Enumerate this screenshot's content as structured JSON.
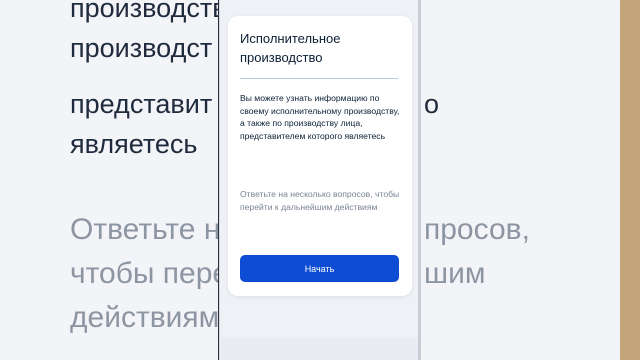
{
  "background": {
    "lines": [
      "производств",
      "производст",
      "представит",
      "являетесь"
    ],
    "right_lines_1": "о",
    "muted_lines": [
      "Ответьте н",
      "чтобы пере",
      "действиям"
    ],
    "muted_right": [
      "просов,",
      "шим",
      ""
    ]
  },
  "card": {
    "title": "Исполнительное производство",
    "body": "Вы можете узнать информацию по своему исполнительному производству, а также по производству лица, представителем которого являетесь",
    "hint": "Ответьте на несколько вопросов, чтобы перейти к дальнейшим действиям",
    "start_label": "Начать"
  },
  "colors": {
    "accent": "#0d4cd3",
    "title": "#0b1f35",
    "muted": "#7a8494",
    "divider": "#b7c8dd"
  }
}
